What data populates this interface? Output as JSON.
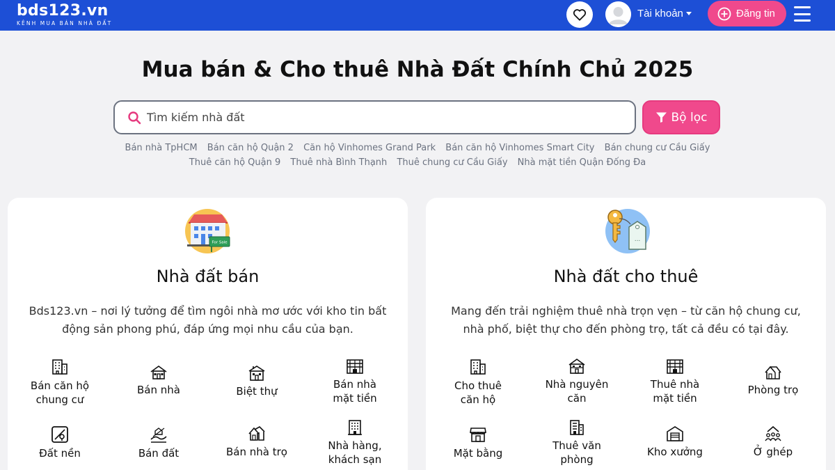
{
  "header": {
    "logo": "bds123.vn",
    "tagline": "KÊNH MUA BÁN NHÀ ĐẤT",
    "account_label": "Tài khoản",
    "post_label": "Đăng tin",
    "brand_color": "#1d4fd6",
    "accent_color": "#f0498c"
  },
  "hero": {
    "title": "Mua bán & Cho thuê Nhà Đất Chính Chủ 2025",
    "search_placeholder": "Tìm kiếm nhà đất",
    "filter_label": "Bộ lọc",
    "quick_links_row1": [
      "Bán nhà TpHCM",
      "Bán căn hộ Quận 2",
      "Căn hộ Vinhomes Grand Park",
      "Bán căn hộ Vinhomes Smart City",
      "Bán chung cư Cầu Giấy"
    ],
    "quick_links_row2": [
      "Thuê căn hộ Quận 9",
      "Thuê nhà Bình Thạnh",
      "Thuê chung cư Cầu Giấy",
      "Nhà mặt tiền Quận Đống Đa"
    ]
  },
  "sale": {
    "icon": "house-for-sale-icon",
    "sign_text": "For Sale",
    "title": "Nhà đất bán",
    "description": "Bds123.vn – nơi lý tưởng để tìm ngôi nhà mơ ước với kho tin bất động sản phong phú, đáp ứng mọi nhu cầu của bạn.",
    "categories": [
      {
        "line1": "Bán căn hộ",
        "line2": "chung cư",
        "icon": "apartment-icon"
      },
      {
        "line1": "Bán nhà",
        "line2": "",
        "icon": "house-icon"
      },
      {
        "line1": "Biệt thự",
        "line2": "",
        "icon": "villa-icon"
      },
      {
        "line1": "Bán nhà",
        "line2": "mặt tiền",
        "icon": "storefront-building-icon"
      },
      {
        "line1": "Đất nền",
        "line2": "",
        "icon": "land-plot-icon"
      },
      {
        "line1": "Bán đất",
        "line2": "",
        "icon": "land-icon"
      },
      {
        "line1": "Bán nhà trọ",
        "line2": "",
        "icon": "boarding-house-icon"
      },
      {
        "line1": "Nhà hàng,",
        "line2": "khách sạn",
        "icon": "hotel-icon"
      }
    ]
  },
  "rent": {
    "icon": "key-tag-icon",
    "tag_text": "...",
    "title": "Nhà đất cho thuê",
    "description": "Mang đến trải nghiệm thuê nhà trọn vẹn – từ căn hộ chung cư, nhà phố, biệt thự cho đến phòng trọ, tất cả đều có tại đây.",
    "categories": [
      {
        "line1": "Cho thuê",
        "line2": "căn hộ",
        "icon": "apartment-icon"
      },
      {
        "line1": "Nhà nguyên",
        "line2": "căn",
        "icon": "whole-house-icon"
      },
      {
        "line1": "Thuê nhà",
        "line2": "mặt tiền",
        "icon": "storefront-building-icon"
      },
      {
        "line1": "Phòng trọ",
        "line2": "",
        "icon": "room-icon"
      },
      {
        "line1": "Mặt bằng",
        "line2": "",
        "icon": "shop-icon"
      },
      {
        "line1": "Thuê văn",
        "line2": "phòng",
        "icon": "office-icon"
      },
      {
        "line1": "Kho xưởng",
        "line2": "",
        "icon": "warehouse-icon"
      },
      {
        "line1": "Ở ghép",
        "line2": "",
        "icon": "shared-living-icon"
      }
    ]
  }
}
